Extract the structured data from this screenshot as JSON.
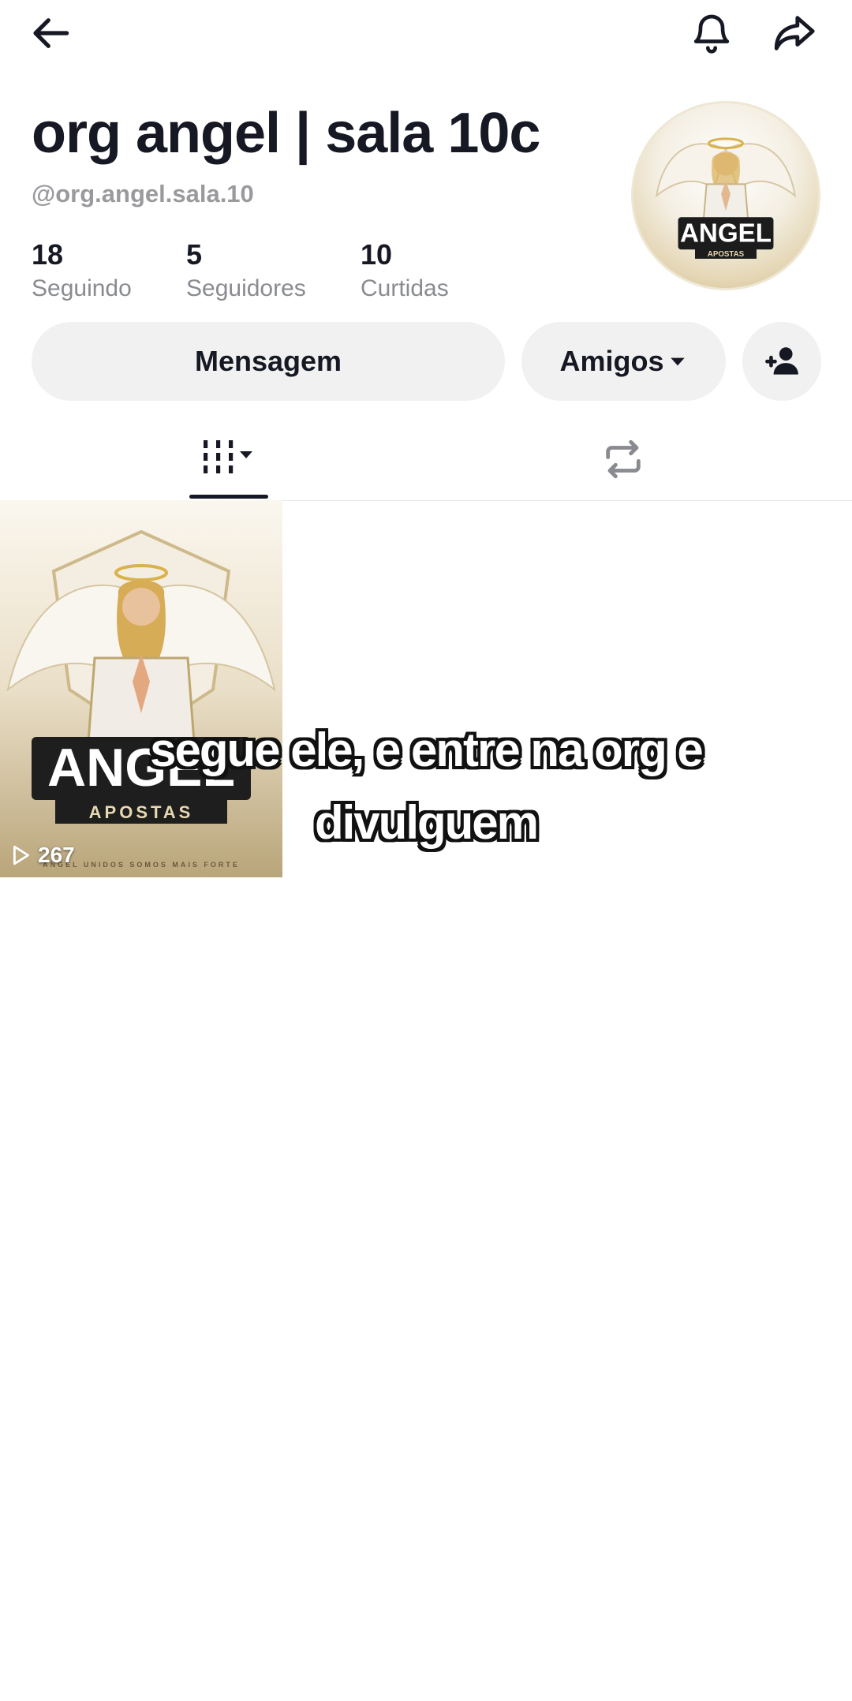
{
  "profile": {
    "display_name": "org angel | sala 10c",
    "username": "@org.angel.sala.10",
    "avatar_text": "ANGEL",
    "avatar_subtext": "APOSTAS"
  },
  "stats": [
    {
      "value": "18",
      "label": "Seguindo"
    },
    {
      "value": "5",
      "label": "Seguidores"
    },
    {
      "value": "10",
      "label": "Curtidas"
    }
  ],
  "actions": {
    "message_label": "Mensagem",
    "friends_label": "Amigos"
  },
  "tabs": [
    {
      "icon": "grid-icon",
      "active": true
    },
    {
      "icon": "repost-icon",
      "active": false
    }
  ],
  "videos": [
    {
      "play_count": "267",
      "thumb_title": "ANGEL",
      "thumb_subtitle": "APOSTAS",
      "thumb_footer": "ANGEL UNIDOS SOMOS MAIS FORTE"
    }
  ],
  "caption": {
    "line1": "segue ele, e entre na org e",
    "line2": "divulguem"
  },
  "icons": {
    "back": "back-arrow-icon",
    "notification": "bell-icon",
    "share": "share-icon",
    "add_friend": "add-user-icon"
  }
}
